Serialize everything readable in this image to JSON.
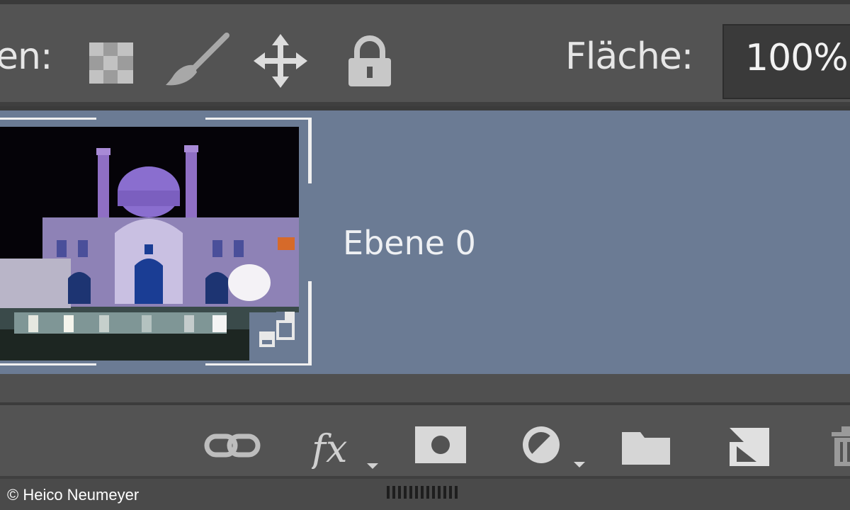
{
  "lock_bar": {
    "label": "en:",
    "fill_label": "Fläche:",
    "fill_value": "100%",
    "icons": [
      "transparency-pixels-icon",
      "brush-icon",
      "move-icon",
      "lock-icon"
    ]
  },
  "layer": {
    "name": "Ebene 0",
    "thumbnail": "mosque-night-thumbnail",
    "badge": "smart-object-icon"
  },
  "panel_bar": {
    "icons": [
      "link-icon",
      "fx-icon",
      "mask-icon",
      "adjustment-icon",
      "folder-icon",
      "new-layer-icon",
      "trash-icon"
    ],
    "fx_label": "fx"
  },
  "credit": "© Heico Neumeyer",
  "colors": {
    "panel_bg": "#535353",
    "selected_layer": "#6b7b94",
    "text": "#e6e6e6"
  }
}
